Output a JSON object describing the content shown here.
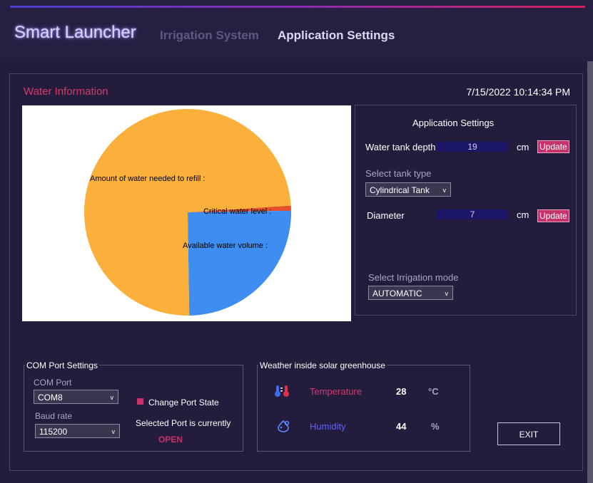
{
  "header": {
    "brand": "Smart Launcher",
    "nav": [
      "Irrigation System",
      "Application Settings"
    ],
    "accent_gradient": [
      "#4a3fd0",
      "#d01f5a"
    ]
  },
  "water_info": {
    "title": "Water Information",
    "datetime": "7/15/2022 10:14:34 PM"
  },
  "chart_data": {
    "type": "pie",
    "slices": [
      {
        "label": "Amount of water needed to refill :",
        "value": 74.2,
        "color": "#fbb03b"
      },
      {
        "label": "Critical water level :",
        "value": 0.8,
        "color": "#e3502a"
      },
      {
        "label": "Available water volume :",
        "value": 25.0,
        "color": "#3d8ef0"
      }
    ]
  },
  "settings": {
    "title": "Application Settings",
    "depth_label": "Water tank depth",
    "depth_value": "19",
    "unit_cm": "cm",
    "update_label": "Update",
    "tank_type_label": "Select tank type",
    "tank_type_value": "Cylindrical Tank",
    "diameter_label": "Diameter",
    "diameter_value": "7",
    "irrigation_label": "Select Irrigation mode",
    "irrigation_value": "AUTOMATIC",
    "caret": "v"
  },
  "com": {
    "title": "COM Port Settings",
    "port_label": "COM Port",
    "port_value": "COM8",
    "baud_label": "Baud rate",
    "baud_value": "115200",
    "change_state": "Change Port State",
    "status_text": "Selected Port is currently",
    "status_value": "OPEN"
  },
  "weather": {
    "title": "Weather inside solar greenhouse",
    "temp_label": "Temperature",
    "temp_value": "28",
    "temp_unit": "°C",
    "humidity_label": "Humidity",
    "humidity_value": "44",
    "humidity_unit": "%",
    "temp_color": "#d43b6b",
    "humidity_color": "#5b63ff"
  },
  "exit_label": "EXIT"
}
